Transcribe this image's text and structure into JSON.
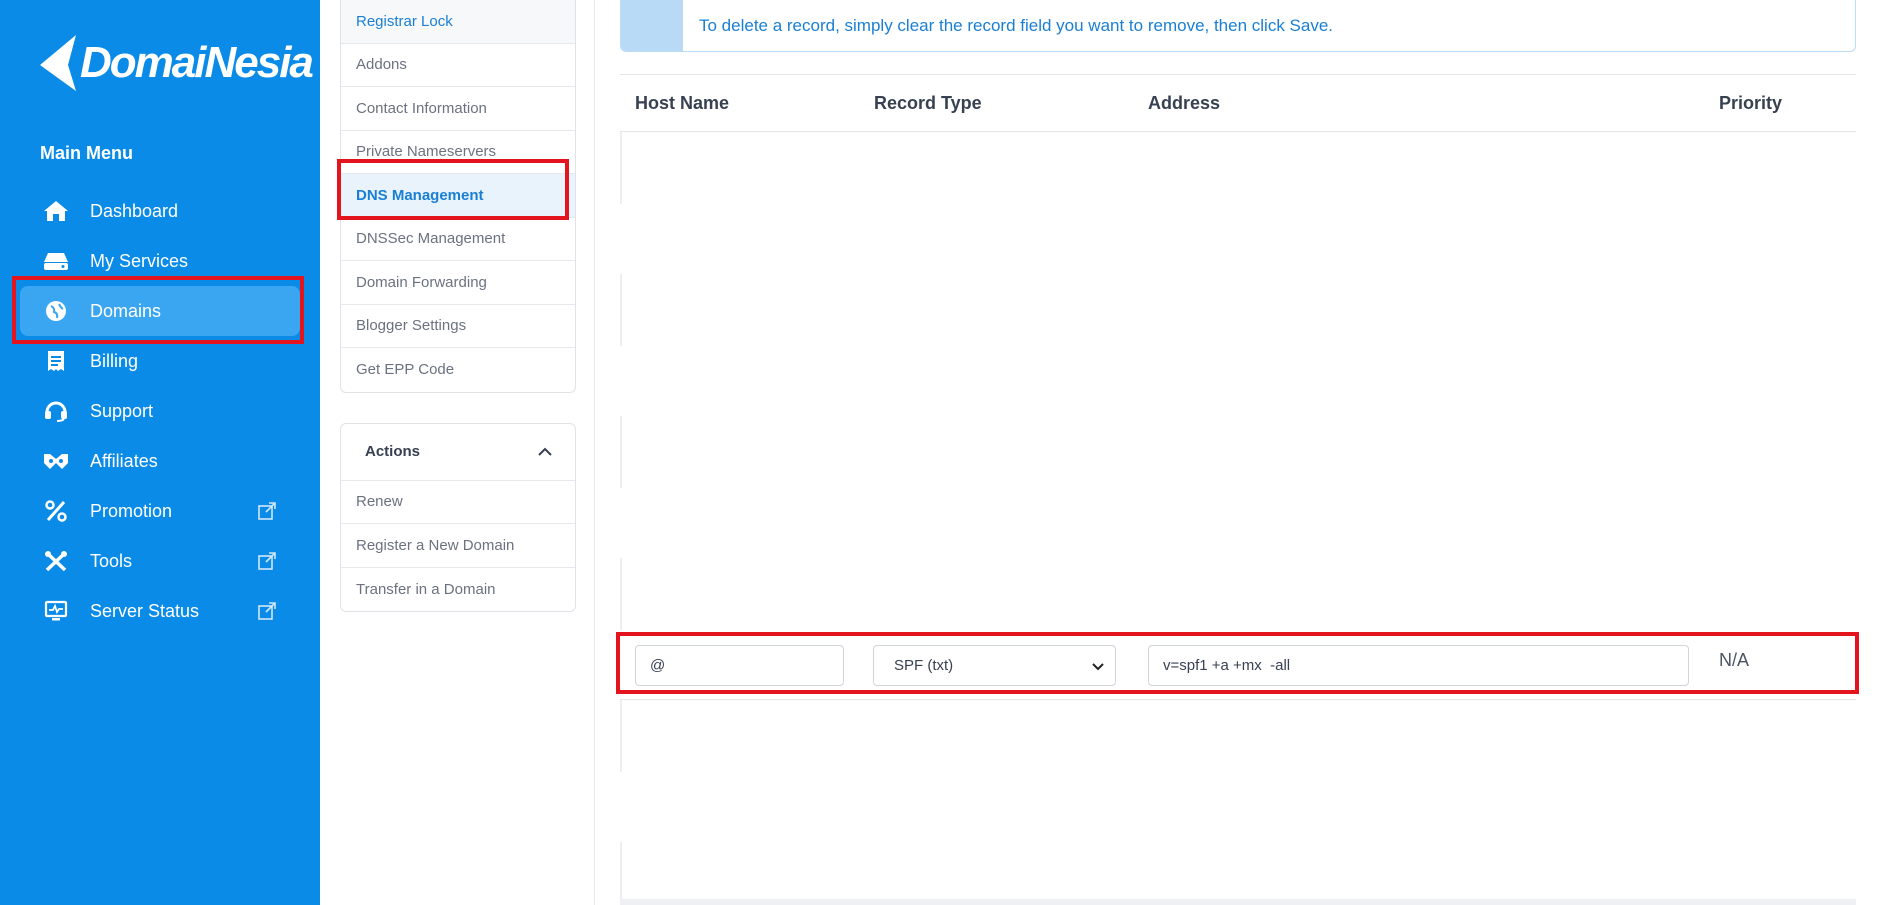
{
  "brand": {
    "name": "DomaiNesia"
  },
  "sidebar": {
    "title": "Main Menu",
    "items": [
      {
        "label": "Dashboard",
        "icon": "home-icon"
      },
      {
        "label": "My Services",
        "icon": "server-icon"
      },
      {
        "label": "Domains",
        "icon": "globe-icon",
        "active": true
      },
      {
        "label": "Billing",
        "icon": "receipt-icon"
      },
      {
        "label": "Support",
        "icon": "headset-icon"
      },
      {
        "label": "Affiliates",
        "icon": "handshake-icon"
      },
      {
        "label": "Promotion",
        "icon": "percent-icon",
        "external": true
      },
      {
        "label": "Tools",
        "icon": "tools-icon",
        "external": true
      },
      {
        "label": "Server Status",
        "icon": "monitor-icon",
        "external": true
      }
    ]
  },
  "manage_menu": {
    "items": [
      {
        "label": "Registrar Lock"
      },
      {
        "label": "Addons"
      },
      {
        "label": "Contact Information"
      },
      {
        "label": "Private Nameservers"
      },
      {
        "label": "DNS Management",
        "current": true
      },
      {
        "label": "DNSSec Management"
      },
      {
        "label": "Domain Forwarding"
      },
      {
        "label": "Blogger Settings"
      },
      {
        "label": "Get EPP Code"
      }
    ]
  },
  "actions": {
    "title": "Actions",
    "items": [
      {
        "label": "Renew"
      },
      {
        "label": "Register a New Domain"
      },
      {
        "label": "Transfer in a Domain"
      }
    ]
  },
  "alert": {
    "text": "To delete a record, simply clear the record field you want to remove, then click Save."
  },
  "table": {
    "headers": {
      "host": "Host Name",
      "type": "Record Type",
      "address": "Address",
      "priority": "Priority"
    },
    "record": {
      "host": "@",
      "type": "SPF (txt)",
      "address": "v=spf1 +a +mx  -all",
      "priority": "N/A"
    }
  },
  "colors": {
    "sidebar": "#0a8be8",
    "highlight": "#e3141d",
    "link": "#1a7fd4"
  }
}
